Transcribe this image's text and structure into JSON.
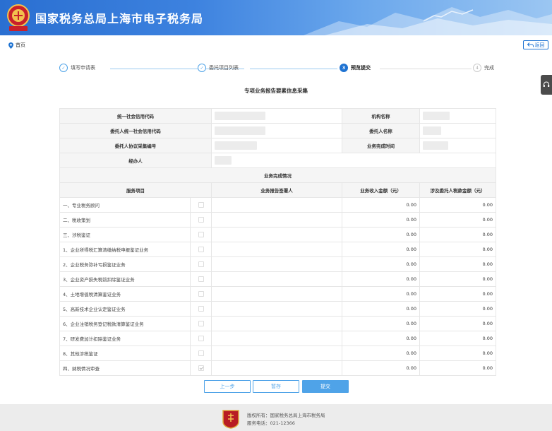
{
  "header": {
    "title": "国家税务总局上海市电子税务局",
    "emblem_text": "中国税务"
  },
  "topbar": {
    "home_label": "首页",
    "back_label": "返回"
  },
  "steps": [
    {
      "index": "1",
      "label": "填写申请表",
      "state": "done"
    },
    {
      "index": "2",
      "label": "委托项目列表",
      "state": "done"
    },
    {
      "index": "3",
      "label": "预览提交",
      "state": "active"
    },
    {
      "index": "4",
      "label": "完成",
      "state": "todo"
    }
  ],
  "form": {
    "title": "专项业务报告要素信息采集",
    "fields": {
      "credit_code_label": "统一社会信用代码",
      "org_name_label": "机构名称",
      "client_credit_code_label": "委托人统一社会信用代码",
      "client_name_label": "委托人名称",
      "agreement_no_label": "委托人协议采集编号",
      "completion_time_label": "业务完成时间",
      "handler_label": "经办人"
    },
    "section_title": "业务完成情况",
    "columns": [
      "服务项目",
      "业务报告签署人",
      "业务收入金额（元）",
      "涉及委托人税款金额（元）"
    ],
    "rows": [
      {
        "item": "一、专业税务顾问",
        "checked": false,
        "income": "0.00",
        "tax": "0.00"
      },
      {
        "item": "二、税收策划",
        "checked": false,
        "income": "0.00",
        "tax": "0.00"
      },
      {
        "item": "三、涉税鉴证",
        "checked": false,
        "income": "0.00",
        "tax": "0.00"
      },
      {
        "item": "1、企业所得税汇算清缴纳税申报鉴证业务",
        "checked": false,
        "income": "0.00",
        "tax": "0.00"
      },
      {
        "item": "2、企业税务弥补亏损鉴证业务",
        "checked": false,
        "income": "0.00",
        "tax": "0.00"
      },
      {
        "item": "3、企业资产损失税前扣除鉴证业务",
        "checked": false,
        "income": "0.00",
        "tax": "0.00"
      },
      {
        "item": "4、土地增值税清算鉴证业务",
        "checked": false,
        "income": "0.00",
        "tax": "0.00"
      },
      {
        "item": "5、高新技术企业认定鉴证业务",
        "checked": false,
        "income": "0.00",
        "tax": "0.00"
      },
      {
        "item": "6、企业注销税务登记税款清算鉴证业务",
        "checked": false,
        "income": "0.00",
        "tax": "0.00"
      },
      {
        "item": "7、研发费加计扣除鉴证业务",
        "checked": false,
        "income": "0.00",
        "tax": "0.00"
      },
      {
        "item": "8、其他涉税鉴证",
        "checked": false,
        "income": "0.00",
        "tax": "0.00"
      },
      {
        "item": "四、纳税情况审查",
        "checked": true,
        "income": "0.00",
        "tax": "0.00"
      }
    ]
  },
  "buttons": {
    "prev": "上一步",
    "save": "暂存",
    "submit": "提交"
  },
  "footer": {
    "copyright": "版权所有：国家税务总局上海市税务局",
    "hotline": "服务电话：021-12366"
  },
  "colors": {
    "primary": "#1f73d2",
    "accent": "#4fa3e8",
    "footer_bg": "#ececec"
  }
}
